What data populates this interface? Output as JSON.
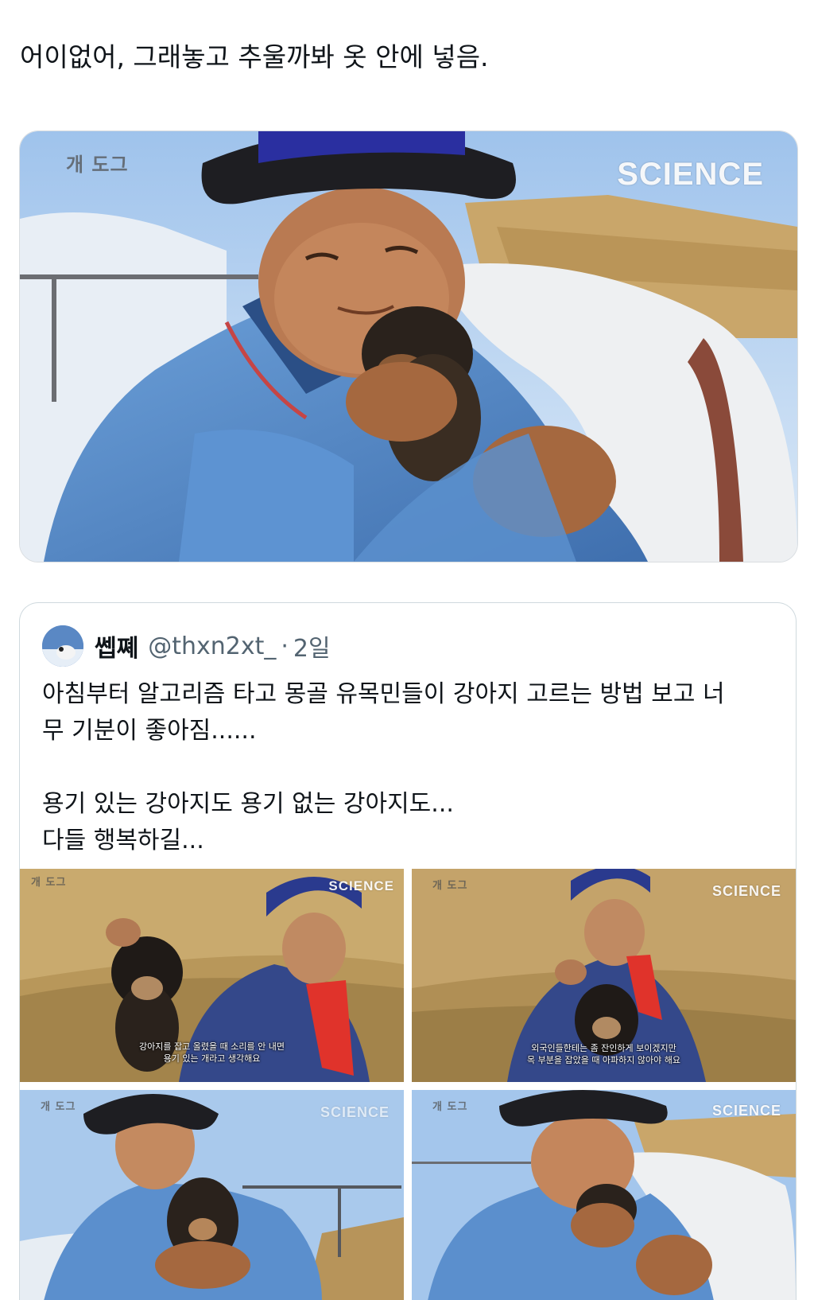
{
  "tweet": {
    "text": "어이없어, 그래놓고 추울까봐 옷 안에 넣음."
  },
  "watermarks": {
    "logo": "개 도그",
    "brand": "SCIENCE"
  },
  "quoted_tweet": {
    "display_name": "쎕쪠",
    "handle": "@thxn2xt_",
    "separator": "·",
    "time": "2일",
    "text": "아침부터 알고리즘 타고 몽골 유목민들이 강아지 고르는 방법 보고 너\n무 기분이 좋아짐......\n\n용기 있는 강아지도 용기 없는 강아지도...\n다들 행복하길..."
  },
  "media_subtitles": {
    "top_left": "강아지를 잡고 올렸을 때 소리를 안 내면\n용기 있는 개라고 생각해요",
    "top_right": "외국인들한테는 좀 잔인하게 보이겠지만\n목 부분을 잡았을 때 아파하지 않아야 해요"
  },
  "colors": {
    "text_primary": "#0f1419",
    "text_secondary": "#536471",
    "border": "#cfd9de",
    "robe_blue": "#4f86c6",
    "sky_blue": "#bcd6f0",
    "straw": "#b89a5e"
  },
  "icons": {
    "avatar": "avatar-photo",
    "logo": "tv-logo-icon"
  }
}
